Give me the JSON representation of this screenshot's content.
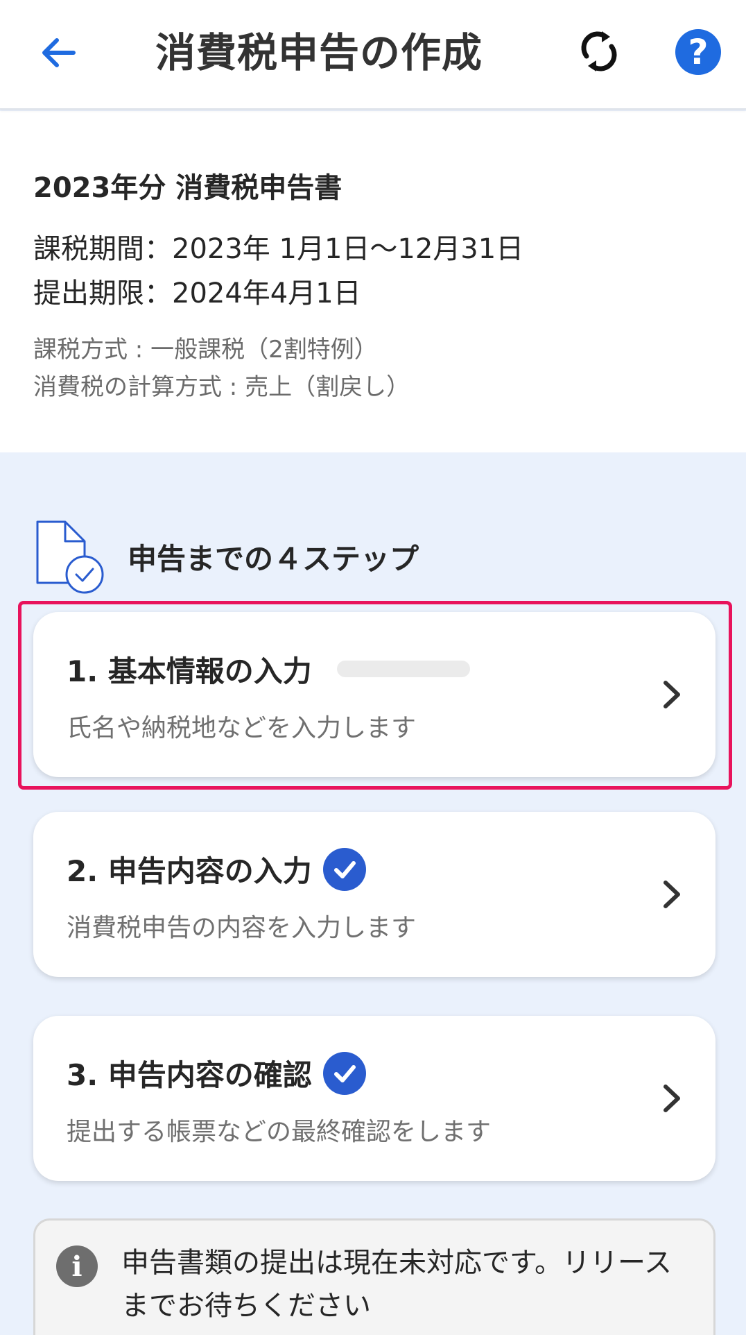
{
  "header": {
    "title": "消費税申告の作成",
    "back_icon": "arrow-left-icon",
    "sync_icon": "sync-icon",
    "help_icon": "help-icon",
    "help_glyph": "?"
  },
  "summary": {
    "doc_title": "2023年分 消費税申告書",
    "period": "課税期間：2023年 1月1日〜12月31日",
    "deadline": "提出期限：2024年4月1日",
    "method": "課税方式 : 一般課税（2割特例）",
    "calc": "消費税の計算方式 : 売上（割戻し）"
  },
  "steps_section": {
    "heading": "申告までの４ステップ",
    "icon": "document-check-icon"
  },
  "steps": [
    {
      "title": "1. 基本情報の入力",
      "description": "氏名や納税地などを入力します",
      "status": "in-progress"
    },
    {
      "title": "2. 申告内容の入力",
      "description": "消費税申告の内容を入力します",
      "status": "done"
    },
    {
      "title": "3. 申告内容の確認",
      "description": "提出する帳票などの最終確認をします",
      "status": "done"
    }
  ],
  "notice": {
    "icon": "info-icon",
    "glyph": "i",
    "text": "申告書類の提出は現在未対応です。リリースまでお待ちください"
  },
  "colors": {
    "accent": "#1f6be0",
    "check": "#2a5ccf",
    "highlight": "#e8135c",
    "background": "#eaf1fc"
  }
}
